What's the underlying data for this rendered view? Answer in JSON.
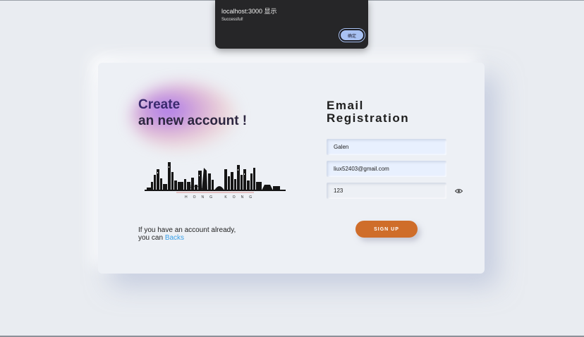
{
  "alert": {
    "title": "localhost:3000 显示",
    "message": "Successful!",
    "ok_label": "确定"
  },
  "left": {
    "headline_line1": "Create",
    "headline_line2": "an new account !",
    "skyline_label": "HONG KONG",
    "note_line1": "If you have an account already,",
    "note_prefix": "you can ",
    "back_link": "Backs"
  },
  "form": {
    "title_line1": "Email",
    "title_line2": "Registration",
    "name_value": "Galen",
    "email_value": "liux52403@gmail.com",
    "password_value": "123",
    "signup_label": "SIGN UP",
    "eye_icon": "eye-icon"
  },
  "colors": {
    "accent": "#cf6d2a",
    "link": "#3aa0e8",
    "autofill": "#e8f0fe",
    "dialog_bg": "#262628",
    "dialog_button": "#a9c2f3"
  }
}
